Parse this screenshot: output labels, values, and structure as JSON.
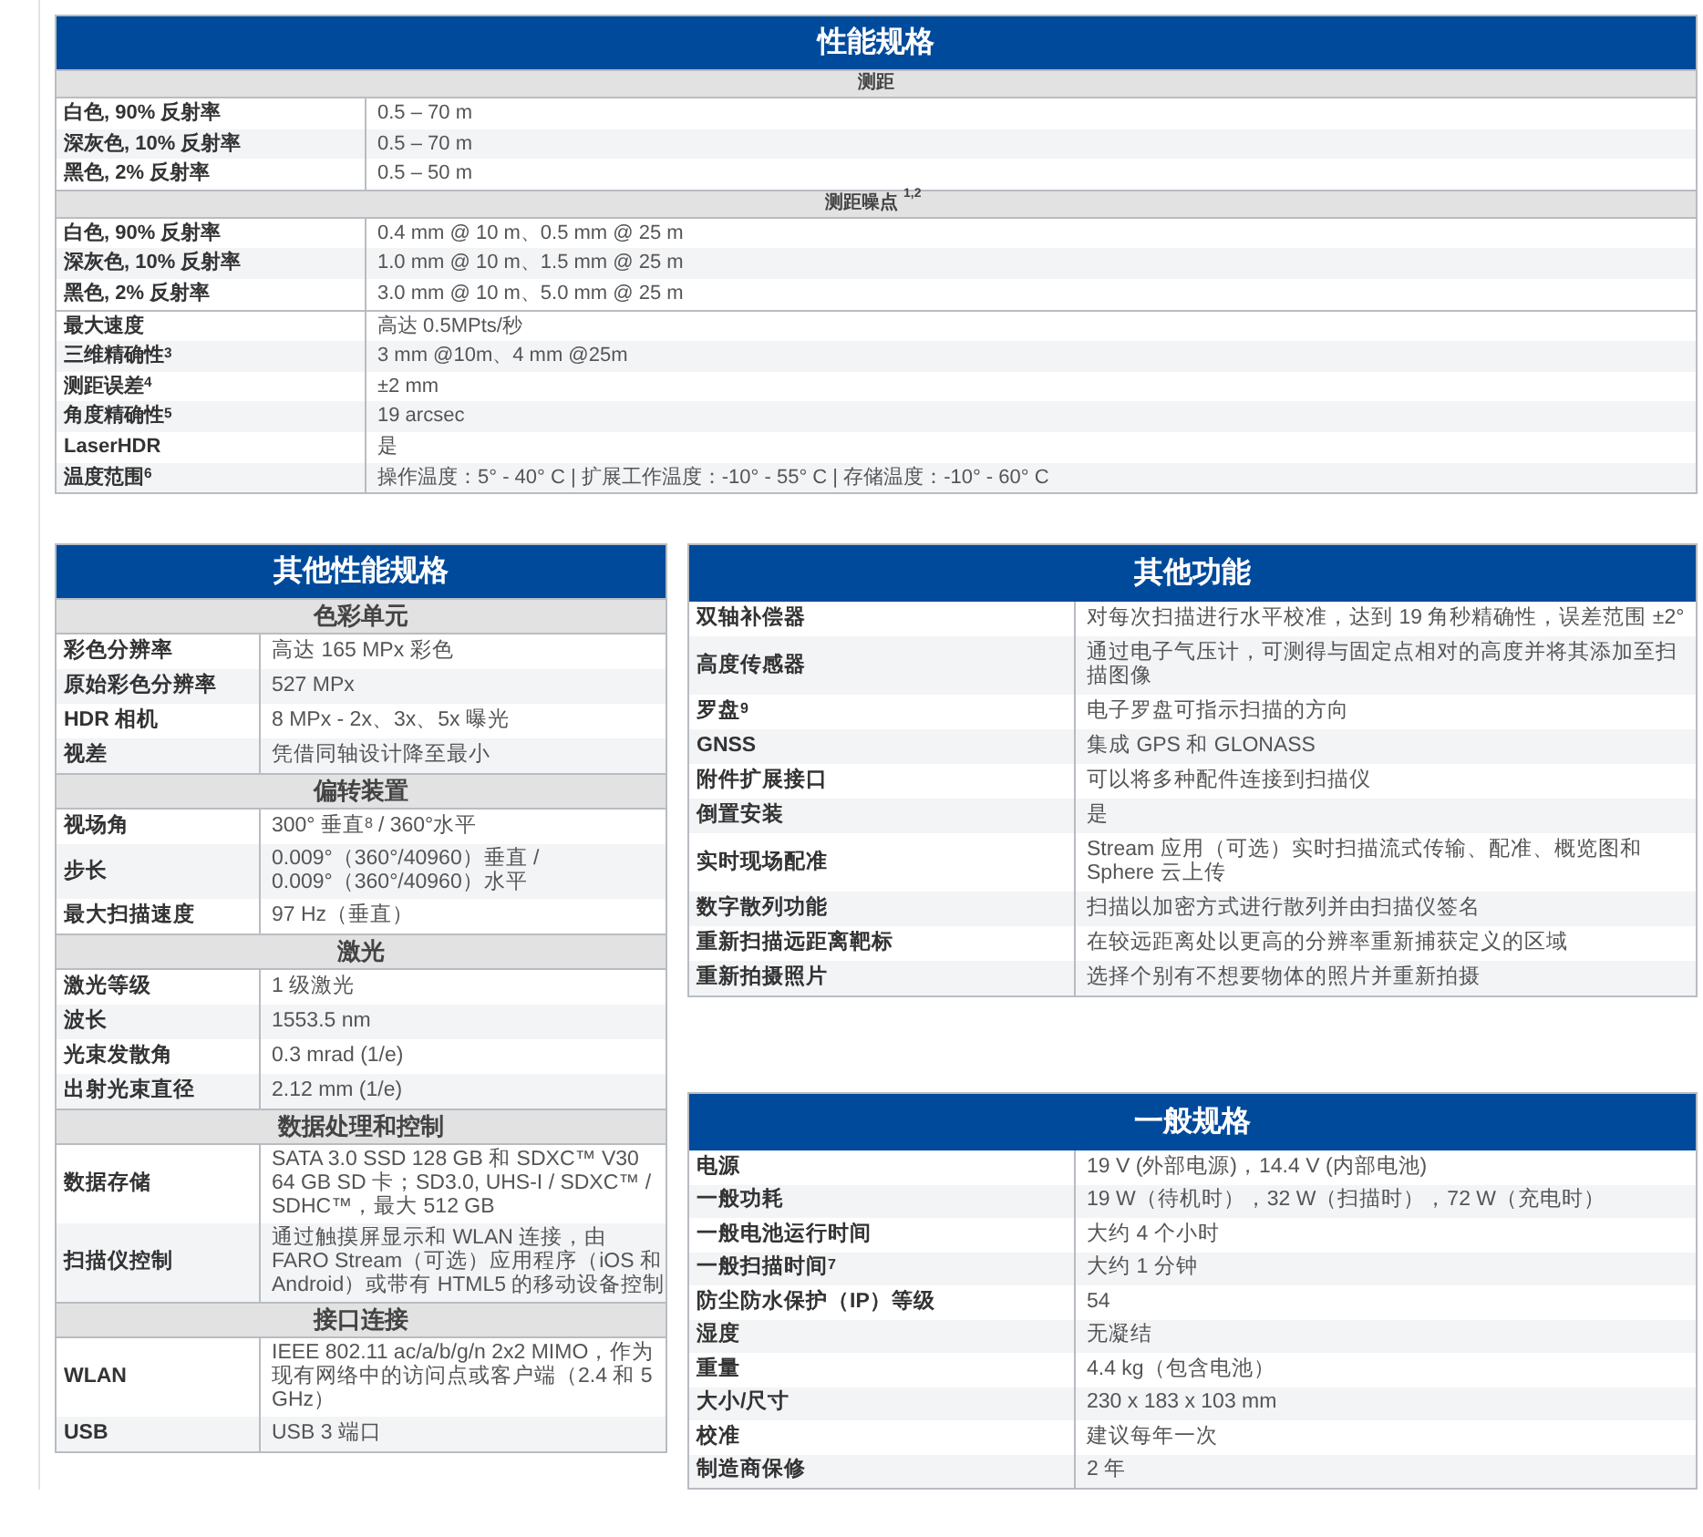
{
  "tables": [
    {
      "title": "性能规格",
      "sections": [
        {
          "heading": "测距",
          "rows": [
            {
              "label": "白色, 90% 反射率",
              "value": "0.5 – 70 m"
            },
            {
              "label": "深灰色, 10% 反射率",
              "value": "0.5 – 70 m"
            },
            {
              "label": "黑色, 2% 反射率",
              "value": "0.5 – 50 m"
            }
          ]
        },
        {
          "heading": "测距噪点 $^{1,2}$",
          "rows": [
            {
              "label": "白色, 90% 反射率",
              "value": "0.4 mm @ 10 m、0.5 mm @ 25 m"
            },
            {
              "label": "深灰色, 10% 反射率",
              "value": "1.0 mm @ 10 m、1.5 mm @ 25 m"
            },
            {
              "label": "黑色, 2% 反射率",
              "value": "3.0 mm @ 10 m、5.0 mm @ 25 m"
            }
          ]
        },
        {
          "rows": [
            {
              "label": "最大速度",
              "value": "高达 0.5MPts/秒"
            },
            {
              "label": "三维精确性$^{3}$",
              "value": "3 mm @10m、4 mm @25m"
            },
            {
              "label": "测距误差$^{4}$",
              "value": "±2 mm"
            },
            {
              "label": "角度精确性$^{5}$",
              "value": "19 arcsec"
            },
            {
              "label": "LaserHDR",
              "value": "是"
            },
            {
              "label": "温度范围$^{6}$",
              "value": "操作温度：5° - 40° C | 扩展工作温度：-10° - 55° C | 存储温度：-10° - 60° C"
            }
          ]
        }
      ]
    },
    {
      "title": "其他性能规格",
      "sections": [
        {
          "heading": "色彩单元",
          "rows": [
            {
              "label": "彩色分辨率",
              "value": "高达 165 MPx 彩色"
            },
            {
              "label": "原始彩色分辨率",
              "value": "527 MPx"
            },
            {
              "label": "HDR 相机",
              "value": "8 MPx - 2x、3x、5x 曝光"
            },
            {
              "label": "视差",
              "value": "凭借同轴设计降至最小"
            }
          ]
        },
        {
          "heading": "偏转装置",
          "rows": [
            {
              "label": "视场角",
              "value": "300° 垂直$^{8}$ / 360°水平"
            },
            {
              "label": "步长",
              "value": "0.009°（360°/40960）垂直 / 0.009°（360°/40960）水平"
            },
            {
              "label": "最大扫描速度",
              "value": "97 Hz（垂直）"
            }
          ]
        },
        {
          "heading": "激光",
          "rows": [
            {
              "label": "激光等级",
              "value": "1 级激光"
            },
            {
              "label": "波长",
              "value": "1553.5 nm"
            },
            {
              "label": "光束发散角",
              "value": "0.3 mrad (1/e)"
            },
            {
              "label": "出射光束直径",
              "value": "2.12 mm (1/e)"
            }
          ]
        },
        {
          "heading": "数据处理和控制",
          "rows": [
            {
              "label": "数据存储",
              "value": "SATA 3.0 SSD 128 GB 和 SDXC™ V30 64 GB SD 卡；SD3.0, UHS-I / SDXC™ / SDHC™，最大 512 GB"
            },
            {
              "label": "扫描仪控制",
              "value": "通过触摸屏显示和 WLAN 连接，由 FARO Stream（可选）应用程序（iOS 和 Android）或带有 HTML5 的移动设备控制"
            }
          ]
        },
        {
          "heading": "接口连接",
          "rows": [
            {
              "label": "WLAN",
              "value": "IEEE 802.11 ac/a/b/g/n 2x2 MIMO，作为现有网络中的访问点或客户端（2.4 和 5 GHz）"
            },
            {
              "label": "USB",
              "value": "USB 3 端口"
            }
          ]
        }
      ]
    },
    {
      "title": "其他功能",
      "sections": [
        {
          "rows": [
            {
              "label": "双轴补偿器",
              "value": "对每次扫描进行水平校准，达到 19 角秒精确性，误差范围 ±2°"
            },
            {
              "label": "高度传感器",
              "value": "通过电子气压计，可测得与固定点相对的高度并将其添加至扫描图像"
            },
            {
              "label": "罗盘$^{9}$",
              "value": "电子罗盘可指示扫描的方向"
            },
            {
              "label": "GNSS",
              "value": "集成 GPS 和 GLONASS"
            },
            {
              "label": "附件扩展接口",
              "value": "可以将多种配件连接到扫描仪"
            },
            {
              "label": "倒置安装",
              "value": "是"
            },
            {
              "label": "实时现场配准",
              "value": "Stream 应用（可选）实时扫描流式传输、配准、概览图和 Sphere 云上传"
            },
            {
              "label": "数字散列功能",
              "value": "扫描以加密方式进行散列并由扫描仪签名"
            },
            {
              "label": "重新扫描远距离靶标",
              "value": "在较远距离处以更高的分辨率重新捕获定义的区域"
            },
            {
              "label": "重新拍摄照片",
              "value": "选择个别有不想要物体的照片并重新拍摄"
            }
          ]
        }
      ]
    },
    {
      "title": "一般规格",
      "sections": [
        {
          "rows": [
            {
              "label": "电源",
              "value": "19 V (外部电源)，14.4 V (内部电池)"
            },
            {
              "label": "一般功耗",
              "value": "19 W（待机时），32 W（扫描时），72 W（充电时）"
            },
            {
              "label": "一般电池运行时间",
              "value": "大约 4 个小时"
            },
            {
              "label": "一般扫描时间$^{7}$",
              "value": "大约 1 分钟"
            },
            {
              "label": "防尘防水保护（IP）等级",
              "value": "54"
            },
            {
              "label": "湿度",
              "value": "无凝结"
            },
            {
              "label": "重量",
              "value": "4.4 kg（包含电池）"
            },
            {
              "label": "大小/尺寸",
              "value": "230 x 183 x 103 mm"
            },
            {
              "label": "校准",
              "value": "建议每年一次"
            },
            {
              "label": "制造商保修",
              "value": "2 年"
            }
          ]
        }
      ]
    }
  ]
}
